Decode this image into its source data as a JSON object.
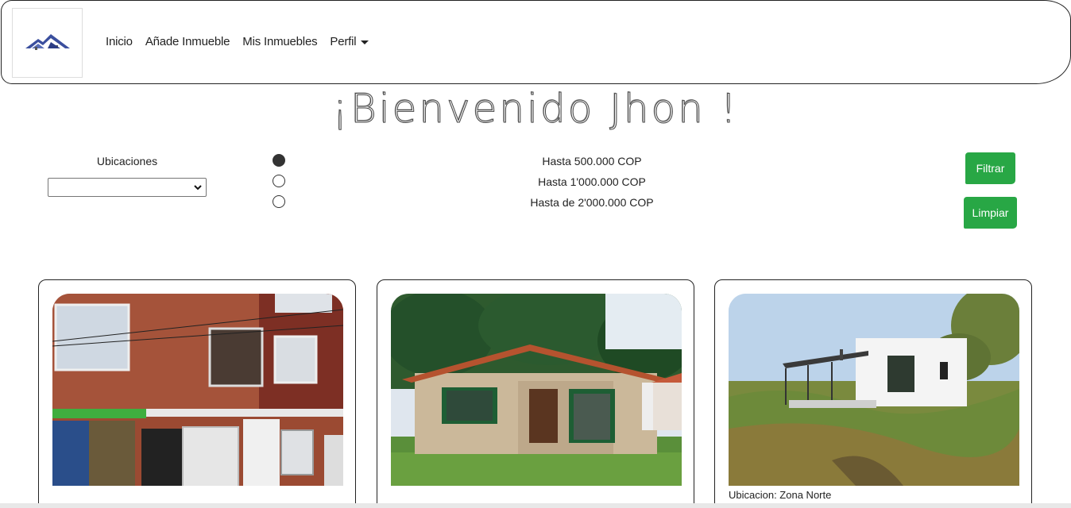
{
  "nav": {
    "links": [
      "Inicio",
      "Añade Inmueble",
      "Mis Inmuebles",
      "Perfil"
    ]
  },
  "welcome": "¡Bienvenido Jhon !",
  "filters": {
    "location_label": "Ubicaciones",
    "location_value": "",
    "price_options": [
      {
        "label": "Hasta 500.000 COP",
        "checked": true
      },
      {
        "label": "Hasta 1'000.000 COP",
        "checked": false
      },
      {
        "label": "Hasta de 2'000.000 COP",
        "checked": false
      }
    ],
    "filter_button": "Filtrar",
    "clear_button": "Limpiar"
  },
  "cards": [
    {
      "image": "brick-apartment-building-photo",
      "caption": ""
    },
    {
      "image": "stone-cottage-photo",
      "caption": ""
    },
    {
      "image": "white-modern-house-photo",
      "caption": "Ubicacion: Zona Norte"
    }
  ],
  "colors": {
    "accent_green": "#28a745",
    "logo_blue": "#3b4f9e"
  }
}
